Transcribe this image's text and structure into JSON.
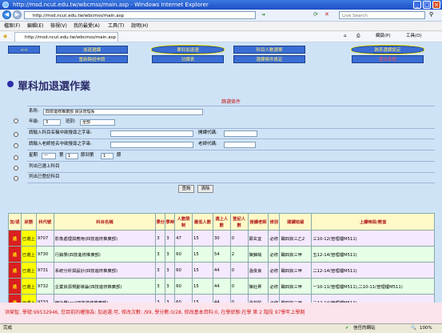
{
  "window": {
    "title": "http://msd.ncut.edu.tw/wbcmss/main.asp - Windows Internet Explorer"
  },
  "address": {
    "url": "http://msd.ncut.edu.tw/wbcmss/main.asp",
    "search_placeholder": "Live Search"
  },
  "menu": [
    "檔案(F)",
    "編輯(E)",
    "檢視(V)",
    "我的最愛(A)",
    "工具(T)",
    "說明(H)"
  ],
  "favbar": {
    "tab_label": "http://msd.ncut.edu.tw/wbcmss/main.asp",
    "page_menu": "網頁(P)",
    "tools_menu": "工具(O)"
  },
  "nav": [
    {
      "label": "<<"
    },
    {
      "label": "加退選課"
    },
    {
      "label": "單科加退選"
    },
    {
      "label": "科目人數選單"
    },
    {
      "label": "跨系選課設定"
    },
    {
      "label": "重新跨班申請"
    },
    {
      "label": "功課表"
    },
    {
      "label": "選課條件設定"
    },
    {
      "label": "登出系統"
    }
  ],
  "page": {
    "title": "單科加退選作業",
    "cond_header": "篩選條件",
    "row1": {
      "dept_label": "系所:",
      "dept_value": "四技進修推廣部 資訊管理系",
      "grade_label": "年級:",
      "grade_value": "3",
      "class_label": "班別:",
      "class_value": "全部"
    },
    "row2": {
      "label": "請輸入科目名稱中欲搜尋之字串:",
      "code_label": "開課代碼:"
    },
    "row3": {
      "label": "請輸入老師姓名中欲搜尋之字串:",
      "teacher_code_label": "老師代碼:"
    },
    "row4": {
      "weekday_label": "星期",
      "weekday_value": "一",
      "period_label": "第",
      "period_value": "1",
      "to_label": "節到第",
      "to_value": "1",
      "end_label": "節"
    },
    "row5": {
      "label": "列出已選上科目"
    },
    "row6": {
      "label": "列出已登記科目"
    },
    "query_button": "查詢",
    "clear_button": "清除"
  },
  "table": {
    "headers": [
      "加/退",
      "狀態",
      "科代號",
      "科目名稱",
      "學分",
      "學時",
      "人數限制",
      "最低人數",
      "選上人數",
      "登記人數",
      "授課老師",
      "修別",
      "開課班級",
      "上課時段/教室"
    ],
    "rows": [
      {
        "add": "退",
        "status": "已選上",
        "code": "9707",
        "name": "影像處理與應用(四技進修推廣部)",
        "credit": "3",
        "hours": "3",
        "limit": "47",
        "min": "15",
        "chosen": "30",
        "reg": "0",
        "teacher": "鄭玄宜",
        "type": "必修",
        "class": "職四資三乙2",
        "time": "三10-12(管理樓M511)"
      },
      {
        "add": "退",
        "status": "已選上",
        "code": "9730",
        "name": "行銷學(四技進修推廣部)",
        "credit": "3",
        "hours": "3",
        "limit": "60",
        "min": "15",
        "chosen": "54",
        "reg": "2",
        "teacher": "陳錦哉",
        "type": "必修",
        "class": "職四資三甲",
        "time": "五12-14(管理樓M511)"
      },
      {
        "add": "退",
        "status": "已選上",
        "code": "9731",
        "name": "系統分析與設計(四技進修推廣部)",
        "credit": "3",
        "hours": "3",
        "limit": "60",
        "min": "15",
        "chosen": "44",
        "reg": "0",
        "teacher": "溫俊良",
        "type": "必修",
        "class": "職四資三甲",
        "time": "二12-14(管理樓M511)"
      },
      {
        "add": "退",
        "status": "已選上",
        "code": "9732",
        "name": "企業資源規劃導論(四技進修推廣部)",
        "credit": "3",
        "hours": "3",
        "limit": "60",
        "min": "15",
        "chosen": "44",
        "reg": "0",
        "teacher": "陳壯昇",
        "type": "必修",
        "class": "職四資三甲",
        "time": "一10-11(管理樓M511),二10-11(管理樓M511)"
      },
      {
        "add": "退",
        "status": "已選上",
        "code": "9733",
        "name": "統計學(一)(四技進修推廣部)",
        "credit": "3",
        "hours": "3",
        "limit": "60",
        "min": "15",
        "chosen": "44",
        "reg": "0",
        "teacher": "溫鈞穀",
        "type": "必修",
        "class": "職四資三甲",
        "time": "三12-14(管理樓M511)"
      }
    ]
  },
  "ticker": "洪榮智, 學號:99532946, 您目前的權限為: 加退選:可, 修改次數: /99, 學分數:0/28, 修改基本資料:0, 在學狀態:在學 第 2 階段 97學年上學期",
  "statusbar": {
    "left": "完成",
    "zone": "信任的網站",
    "zoom": "100%"
  }
}
